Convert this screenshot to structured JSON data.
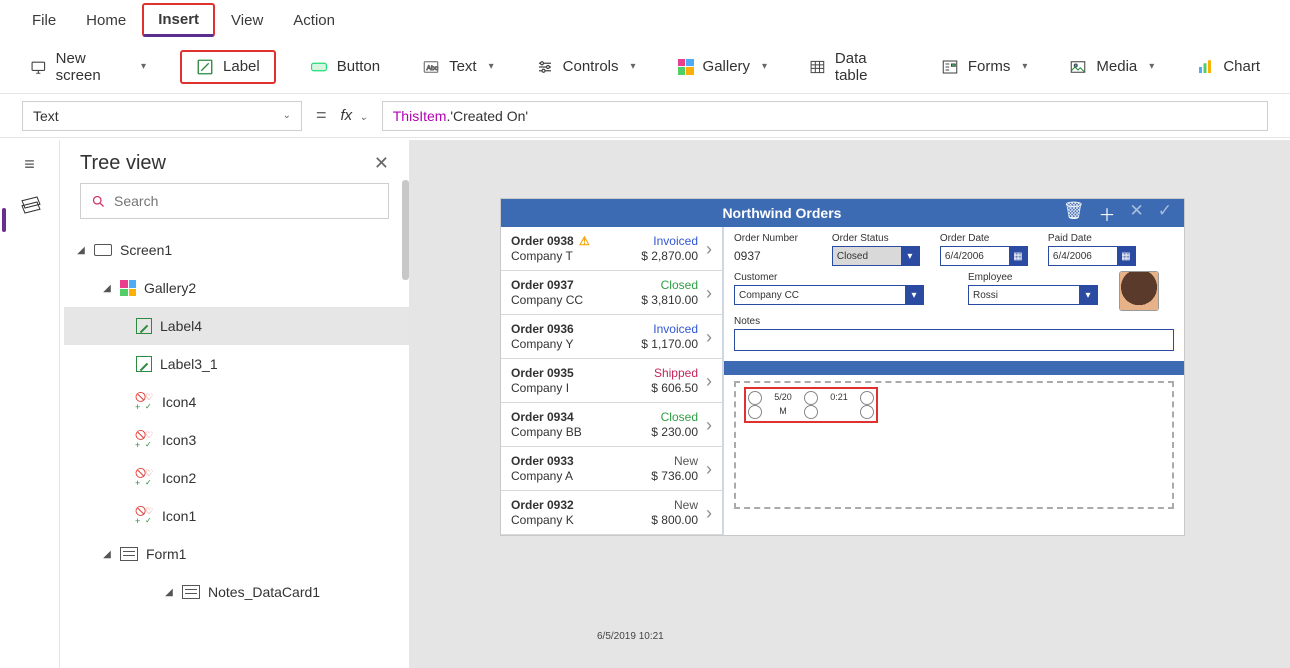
{
  "menubar": {
    "tabs": [
      "File",
      "Home",
      "Insert",
      "View",
      "Action"
    ],
    "active": "Insert"
  },
  "ribbon": {
    "new_screen": "New screen",
    "label": "Label",
    "button": "Button",
    "text": "Text",
    "controls": "Controls",
    "gallery": "Gallery",
    "data_table": "Data table",
    "forms": "Forms",
    "media": "Media",
    "chart": "Chart"
  },
  "formula": {
    "property": "Text",
    "eq": "=",
    "fx": "fx",
    "expr_kw": "ThisItem",
    "expr_rest": ".'Created On'"
  },
  "tree": {
    "title": "Tree view",
    "search_ph": "Search",
    "nodes": [
      {
        "label": "Screen1"
      },
      {
        "label": "Gallery2"
      },
      {
        "label": "Label4"
      },
      {
        "label": "Label3_1"
      },
      {
        "label": "Icon4"
      },
      {
        "label": "Icon3"
      },
      {
        "label": "Icon2"
      },
      {
        "label": "Icon1"
      },
      {
        "label": "Form1"
      },
      {
        "label": "Notes_DataCard1"
      }
    ]
  },
  "app": {
    "title": "Northwind Orders",
    "orders": [
      {
        "num": "Order 0938",
        "cust": "Company T",
        "status": "Invoiced",
        "amt": "$ 2,870.00",
        "warn": true
      },
      {
        "num": "Order 0937",
        "cust": "Company CC",
        "status": "Closed",
        "amt": "$ 3,810.00"
      },
      {
        "num": "Order 0936",
        "cust": "Company Y",
        "status": "Invoiced",
        "amt": "$ 1,170.00"
      },
      {
        "num": "Order 0935",
        "cust": "Company I",
        "status": "Shipped",
        "amt": "$ 606.50"
      },
      {
        "num": "Order 0934",
        "cust": "Company BB",
        "status": "Closed",
        "amt": "$ 230.00"
      },
      {
        "num": "Order 0933",
        "cust": "Company A",
        "status": "New",
        "amt": "$ 736.00"
      },
      {
        "num": "Order 0932",
        "cust": "Company K",
        "status": "New",
        "amt": "$ 800.00"
      }
    ],
    "form": {
      "order_number_lbl": "Order Number",
      "order_number": "0937",
      "order_status_lbl": "Order Status",
      "order_status": "Closed",
      "order_date_lbl": "Order Date",
      "order_date": "6/4/2006",
      "paid_date_lbl": "Paid Date",
      "paid_date": "6/4/2006",
      "customer_lbl": "Customer",
      "customer": "Company CC",
      "employee_lbl": "Employee",
      "employee": "Rossi",
      "notes_lbl": "Notes",
      "notes": ""
    },
    "annot": {
      "a": "5/20",
      "b": "0:21",
      "c": "M"
    },
    "ts2": "6/5/2019 10:21"
  }
}
